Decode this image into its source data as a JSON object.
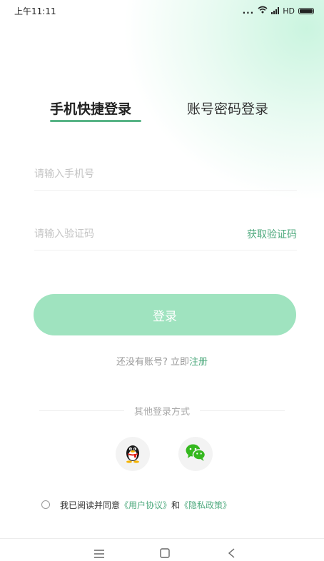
{
  "status_bar": {
    "time": "上午11:11",
    "dots": "...",
    "network": "HD"
  },
  "tabs": {
    "quick_login": "手机快捷登录",
    "password_login": "账号密码登录"
  },
  "phone_field": {
    "placeholder": "请输入手机号"
  },
  "code_field": {
    "placeholder": "请输入验证码",
    "get_code": "获取验证码"
  },
  "login_button": "登录",
  "register": {
    "prompt": "还没有账号? 立即",
    "link": "注册"
  },
  "other_login": {
    "label": "其他登录方式"
  },
  "agreement": {
    "prefix": "我已阅读并同意",
    "user_agreement": "《用户协议》",
    "and": "和",
    "privacy_policy": "《隐私政策》"
  },
  "colors": {
    "accent": "#4faa7e",
    "button": "#9fe3bf",
    "underline": "#58b487"
  },
  "icons": [
    "wifi-icon",
    "signal-icon",
    "battery-icon",
    "qq-icon",
    "wechat-icon",
    "menu-icon",
    "home-icon",
    "back-icon"
  ]
}
